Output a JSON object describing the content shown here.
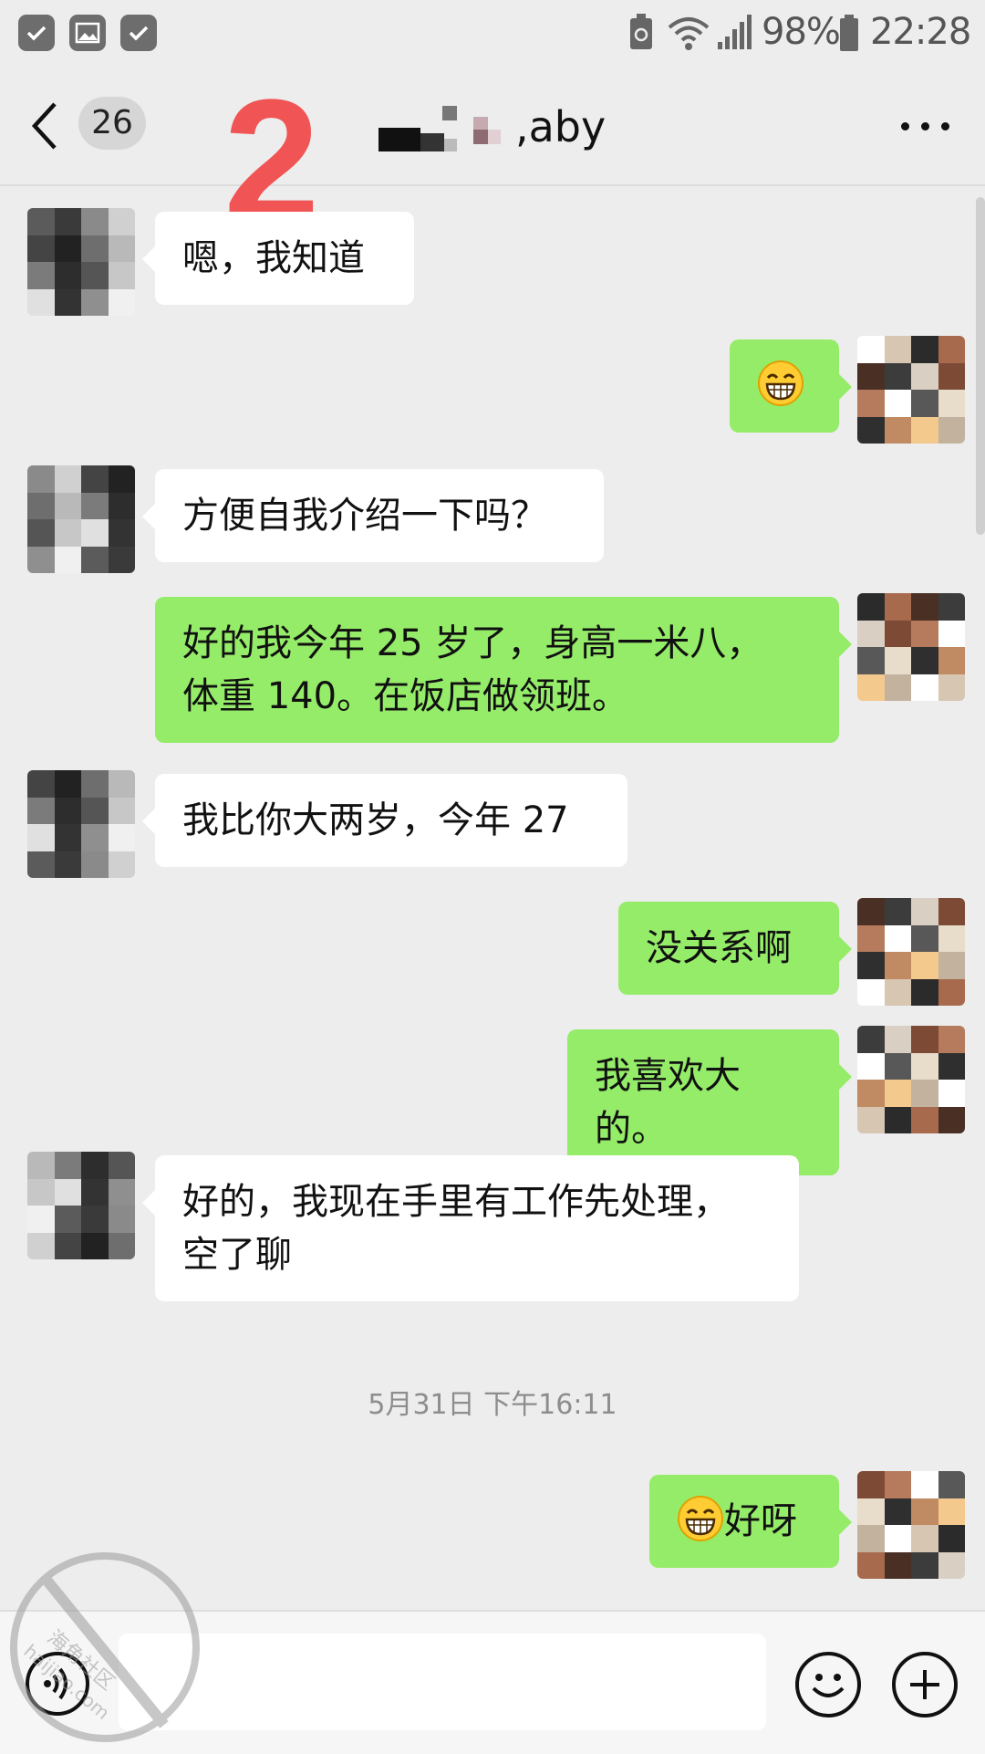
{
  "status_bar": {
    "battery_percent": "98%",
    "time": "22:28",
    "icons": [
      "check-bubble-icon",
      "image-icon",
      "check-bubble-icon",
      "battery-saver-icon",
      "wifi-icon",
      "signal-icon",
      "battery-icon"
    ]
  },
  "header": {
    "back_icon": "chevron-left-icon",
    "unread_count": "26",
    "overlay_number": "2",
    "title_visible": ",aby",
    "more_icon": "more-dots-icon"
  },
  "messages": [
    {
      "side": "in",
      "text": "嗯，我知道"
    },
    {
      "side": "out",
      "emoji": "grin-emoji",
      "text": ""
    },
    {
      "side": "in",
      "text": "方便自我介绍一下吗？"
    },
    {
      "side": "out",
      "text": "好的我今年 25 岁了，身高一米八，\n体重 140。在饭店做领班。"
    },
    {
      "side": "in",
      "text": "我比你大两岁，今年 27"
    },
    {
      "side": "out",
      "text": "没关系啊"
    },
    {
      "side": "out",
      "text": "我喜欢大的。"
    },
    {
      "side": "in",
      "text": "好的，我现在手里有工作先处理，\n空了聊"
    },
    {
      "side": "out",
      "emoji": "grin-emoji",
      "text": "好呀"
    }
  ],
  "timestamp": "5月31日 下午16:11",
  "input_bar": {
    "voice_icon": "voice-icon",
    "emoji_icon": "smiley-icon",
    "plus_icon": "plus-icon",
    "input_value": ""
  },
  "watermark": {
    "text_cn": "海角社区",
    "text_en": "haijiao.com"
  },
  "colors": {
    "background": "#ededed",
    "outgoing_bubble": "#95ec69",
    "incoming_bubble": "#ffffff",
    "overlay_number": "#f05454"
  }
}
